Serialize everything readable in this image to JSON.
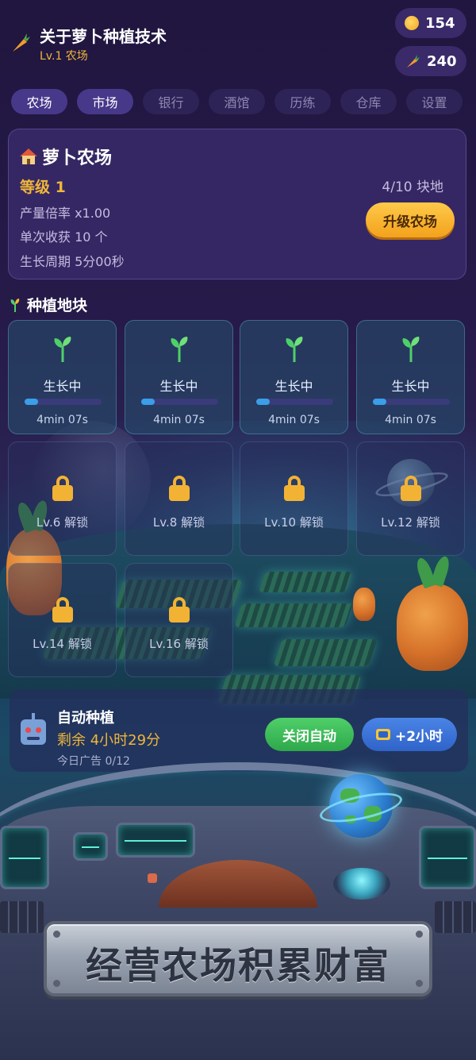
{
  "header": {
    "title": "关于萝卜种植技术",
    "subtitle": "Lv.1 农场",
    "coins": "154",
    "carrots": "240",
    "icons": {
      "logo": "carrot-icon",
      "coins": "coin-icon",
      "carrots": "carrot-icon"
    }
  },
  "tabs": [
    {
      "label": "农场",
      "active": true
    },
    {
      "label": "市场",
      "active": true
    },
    {
      "label": "银行",
      "active": false
    },
    {
      "label": "酒馆",
      "active": false
    },
    {
      "label": "历练",
      "active": false
    },
    {
      "label": "仓库",
      "active": false
    },
    {
      "label": "设置",
      "active": false
    }
  ],
  "farm": {
    "name": "萝卜农场",
    "level": "等级 1",
    "stats": [
      "产量倍率 x1.00",
      "单次收获 10 个",
      "生长周期 5分00秒"
    ],
    "plots_count": "4/10 块地",
    "upgrade_label": "升级农场"
  },
  "plots_section": {
    "title": "种植地块",
    "growing": [
      {
        "status": "生长中",
        "timer": "4min 07s",
        "progress": 0.18
      },
      {
        "status": "生长中",
        "timer": "4min 07s",
        "progress": 0.18
      },
      {
        "status": "生长中",
        "timer": "4min 07s",
        "progress": 0.18
      },
      {
        "status": "生长中",
        "timer": "4min 07s",
        "progress": 0.18
      }
    ],
    "locked": [
      {
        "label": "Lv.6 解锁"
      },
      {
        "label": "Lv.8 解锁"
      },
      {
        "label": "Lv.10 解锁"
      },
      {
        "label": "Lv.12 解锁"
      },
      {
        "label": "Lv.14 解锁"
      },
      {
        "label": "Lv.16 解锁"
      }
    ]
  },
  "auto_plant": {
    "title": "自动种植",
    "remaining": "剩余 4小时29分",
    "ads_today": "今日广告 0/12",
    "off_label": "关闭自动",
    "plus_label": "+2小时"
  },
  "banner": {
    "text": "经营农场积累财富"
  },
  "colors": {
    "accent": "#f0b63a",
    "progress": "#3a9ee8",
    "green_button": "#2ea84a",
    "blue_button": "#2f63c9"
  }
}
